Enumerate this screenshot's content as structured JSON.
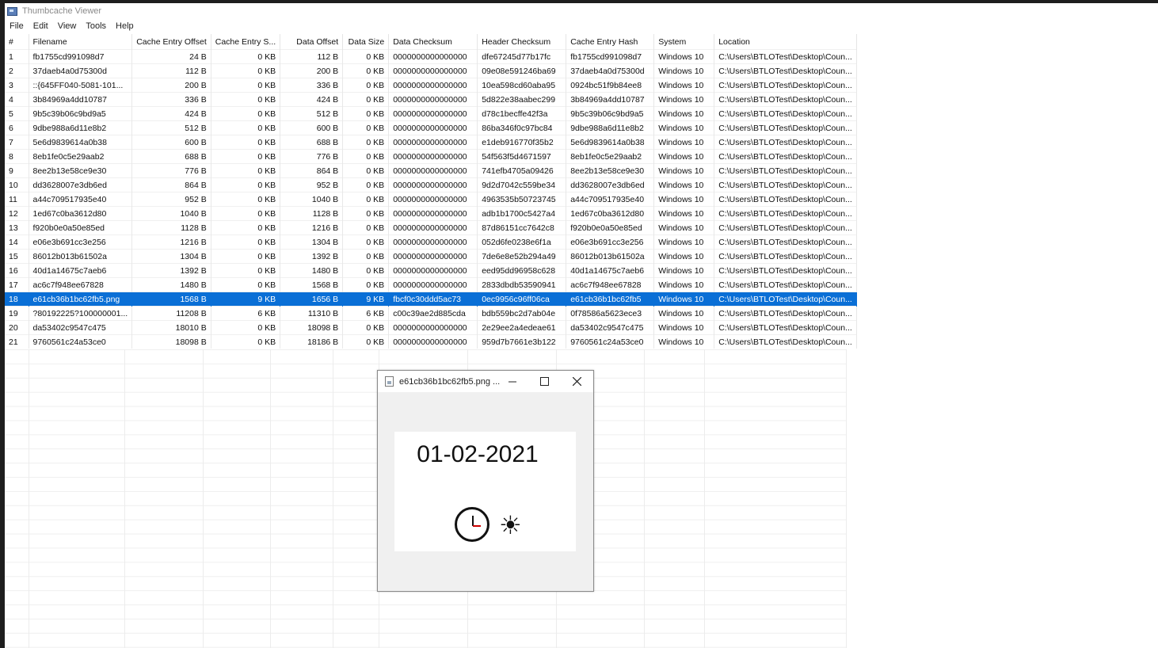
{
  "window": {
    "title": "Thumbcache Viewer"
  },
  "menu": [
    "File",
    "Edit",
    "View",
    "Tools",
    "Help"
  ],
  "columns": [
    "#",
    "Filename",
    "Cache Entry Offset",
    "Cache Entry S...",
    "Data Offset",
    "Data Size",
    "Data Checksum",
    "Header Checksum",
    "Cache Entry Hash",
    "System",
    "Location"
  ],
  "rows": [
    [
      "1",
      "fb1755cd991098d7",
      "24 B",
      "0 KB",
      "112 B",
      "0 KB",
      "0000000000000000",
      "dfe67245d77b17fc",
      "fb1755cd991098d7",
      "Windows 10",
      "C:\\Users\\BTLOTest\\Desktop\\Coun..."
    ],
    [
      "2",
      "37daeb4a0d75300d",
      "112 B",
      "0 KB",
      "200 B",
      "0 KB",
      "0000000000000000",
      "09e08e591246ba69",
      "37daeb4a0d75300d",
      "Windows 10",
      "C:\\Users\\BTLOTest\\Desktop\\Coun..."
    ],
    [
      "3",
      "::{645FF040-5081-101...",
      "200 B",
      "0 KB",
      "336 B",
      "0 KB",
      "0000000000000000",
      "10ea598cd60aba95",
      "0924bc51f9b84ee8",
      "Windows 10",
      "C:\\Users\\BTLOTest\\Desktop\\Coun..."
    ],
    [
      "4",
      "3b84969a4dd10787",
      "336 B",
      "0 KB",
      "424 B",
      "0 KB",
      "0000000000000000",
      "5d822e38aabec299",
      "3b84969a4dd10787",
      "Windows 10",
      "C:\\Users\\BTLOTest\\Desktop\\Coun..."
    ],
    [
      "5",
      "9b5c39b06c9bd9a5",
      "424 B",
      "0 KB",
      "512 B",
      "0 KB",
      "0000000000000000",
      "d78c1becffe42f3a",
      "9b5c39b06c9bd9a5",
      "Windows 10",
      "C:\\Users\\BTLOTest\\Desktop\\Coun..."
    ],
    [
      "6",
      "9dbe988a6d11e8b2",
      "512 B",
      "0 KB",
      "600 B",
      "0 KB",
      "0000000000000000",
      "86ba346f0c97bc84",
      "9dbe988a6d11e8b2",
      "Windows 10",
      "C:\\Users\\BTLOTest\\Desktop\\Coun..."
    ],
    [
      "7",
      "5e6d9839614a0b38",
      "600 B",
      "0 KB",
      "688 B",
      "0 KB",
      "0000000000000000",
      "e1deb916770f35b2",
      "5e6d9839614a0b38",
      "Windows 10",
      "C:\\Users\\BTLOTest\\Desktop\\Coun..."
    ],
    [
      "8",
      "8eb1fe0c5e29aab2",
      "688 B",
      "0 KB",
      "776 B",
      "0 KB",
      "0000000000000000",
      "54f563f5d4671597",
      "8eb1fe0c5e29aab2",
      "Windows 10",
      "C:\\Users\\BTLOTest\\Desktop\\Coun..."
    ],
    [
      "9",
      "8ee2b13e58ce9e30",
      "776 B",
      "0 KB",
      "864 B",
      "0 KB",
      "0000000000000000",
      "741efb4705a09426",
      "8ee2b13e58ce9e30",
      "Windows 10",
      "C:\\Users\\BTLOTest\\Desktop\\Coun..."
    ],
    [
      "10",
      "dd3628007e3db6ed",
      "864 B",
      "0 KB",
      "952 B",
      "0 KB",
      "0000000000000000",
      "9d2d7042c559be34",
      "dd3628007e3db6ed",
      "Windows 10",
      "C:\\Users\\BTLOTest\\Desktop\\Coun..."
    ],
    [
      "11",
      "a44c709517935e40",
      "952 B",
      "0 KB",
      "1040 B",
      "0 KB",
      "0000000000000000",
      "4963535b50723745",
      "a44c709517935e40",
      "Windows 10",
      "C:\\Users\\BTLOTest\\Desktop\\Coun..."
    ],
    [
      "12",
      "1ed67c0ba3612d80",
      "1040 B",
      "0 KB",
      "1128 B",
      "0 KB",
      "0000000000000000",
      "adb1b1700c5427a4",
      "1ed67c0ba3612d80",
      "Windows 10",
      "C:\\Users\\BTLOTest\\Desktop\\Coun..."
    ],
    [
      "13",
      "f920b0e0a50e85ed",
      "1128 B",
      "0 KB",
      "1216 B",
      "0 KB",
      "0000000000000000",
      "87d86151cc7642c8",
      "f920b0e0a50e85ed",
      "Windows 10",
      "C:\\Users\\BTLOTest\\Desktop\\Coun..."
    ],
    [
      "14",
      "e06e3b691cc3e256",
      "1216 B",
      "0 KB",
      "1304 B",
      "0 KB",
      "0000000000000000",
      "052d6fe0238e6f1a",
      "e06e3b691cc3e256",
      "Windows 10",
      "C:\\Users\\BTLOTest\\Desktop\\Coun..."
    ],
    [
      "15",
      "86012b013b61502a",
      "1304 B",
      "0 KB",
      "1392 B",
      "0 KB",
      "0000000000000000",
      "7de6e8e52b294a49",
      "86012b013b61502a",
      "Windows 10",
      "C:\\Users\\BTLOTest\\Desktop\\Coun..."
    ],
    [
      "16",
      "40d1a14675c7aeb6",
      "1392 B",
      "0 KB",
      "1480 B",
      "0 KB",
      "0000000000000000",
      "eed95dd96958c628",
      "40d1a14675c7aeb6",
      "Windows 10",
      "C:\\Users\\BTLOTest\\Desktop\\Coun..."
    ],
    [
      "17",
      "ac6c7f948ee67828",
      "1480 B",
      "0 KB",
      "1568 B",
      "0 KB",
      "0000000000000000",
      "2833dbdb53590941",
      "ac6c7f948ee67828",
      "Windows 10",
      "C:\\Users\\BTLOTest\\Desktop\\Coun..."
    ],
    [
      "18",
      "e61cb36b1bc62fb5.png",
      "1568 B",
      "9 KB",
      "1656 B",
      "9 KB",
      "fbcf0c30ddd5ac73",
      "0ec9956c96ff06ca",
      "e61cb36b1bc62fb5",
      "Windows 10",
      "C:\\Users\\BTLOTest\\Desktop\\Coun..."
    ],
    [
      "19",
      "?80192225?100000001...",
      "11208 B",
      "6 KB",
      "11310 B",
      "6 KB",
      "c00c39ae2d885cda",
      "bdb559bc2d7ab04e",
      "0f78586a5623ece3",
      "Windows 10",
      "C:\\Users\\BTLOTest\\Desktop\\Coun..."
    ],
    [
      "20",
      "da53402c9547c475",
      "18010 B",
      "0 KB",
      "18098 B",
      "0 KB",
      "0000000000000000",
      "2e29ee2a4edeae61",
      "da53402c9547c475",
      "Windows 10",
      "C:\\Users\\BTLOTest\\Desktop\\Coun..."
    ],
    [
      "21",
      "9760561c24a53ce0",
      "18098 B",
      "0 KB",
      "18186 B",
      "0 KB",
      "0000000000000000",
      "959d7b7661e3b122",
      "9760561c24a53ce0",
      "Windows 10",
      "C:\\Users\\BTLOTest\\Desktop\\Coun..."
    ]
  ],
  "selected_row": "18",
  "preview": {
    "title": "e61cb36b1bc62fb5.png ...",
    "image_date": "01-02-2021",
    "icons": [
      "clock-icon",
      "sun-icon"
    ]
  },
  "colors": {
    "selection": "#0a6fd6",
    "background": "#1e1e1e"
  }
}
